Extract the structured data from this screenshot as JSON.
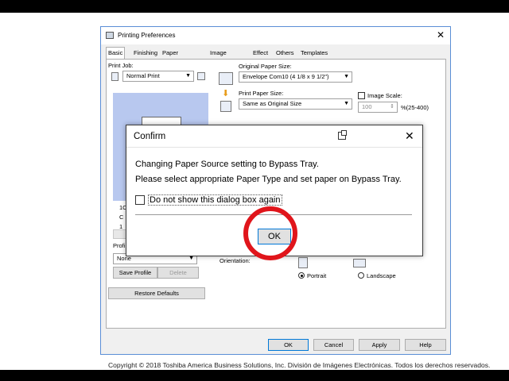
{
  "window": {
    "title": "Printing Preferences",
    "close_glyph": "✕",
    "tabs": [
      {
        "label": "Basic",
        "active": true
      },
      {
        "label": "Finishing"
      },
      {
        "label": "Paper Handling"
      },
      {
        "label": "Image Quality"
      },
      {
        "label": "Effect"
      },
      {
        "label": "Others"
      },
      {
        "label": "Templates"
      }
    ]
  },
  "basic": {
    "print_job_label": "Print Job:",
    "print_job_value": "Normal Print",
    "original_paper_size_label": "Original Paper Size:",
    "original_paper_size_value": "Envelope Com10 (4 1/8 x 9 1/2\")",
    "print_paper_size_label": "Print Paper Size:",
    "print_paper_size_value": "Same as Original Size",
    "image_scale_label": "Image Scale:",
    "image_scale_value": "100",
    "image_scale_range": "%(25-400)",
    "profile_label": "Profi",
    "profile_value": "None",
    "save_profile_label": "Save Profile",
    "delete_label": "Delete",
    "restore_defaults_label": "Restore Defaults",
    "orientation_label": "Orientation:",
    "portrait_label": "Portrait",
    "landscape_label": "Landscape",
    "orientation_selected": "Portrait",
    "preview_partial_1": "1C",
    "preview_partial_2": "C",
    "preview_partial_3": "1"
  },
  "footer_buttons": {
    "ok": "OK",
    "cancel": "Cancel",
    "apply": "Apply",
    "help": "Help"
  },
  "dialog": {
    "title": "Confirm",
    "close_glyph": "✕",
    "message_line1": "Changing Paper Source setting to Bypass Tray.",
    "message_line2": "Please select appropriate Paper Type and set paper on Bypass Tray.",
    "checkbox_label": "Do not show this dialog box again",
    "checkbox_checked": false,
    "ok_label": "OK"
  },
  "annotation": {
    "highlight_color": "#e0151b",
    "target": "OK"
  },
  "colors": {
    "window_border": "#5a8ed6",
    "preview_bg": "#b8c8ef",
    "default_button_border": "#0078d7",
    "arrow_icon": "#e89c1a"
  },
  "copyright": "Copyright © 2018 Toshiba America Business Solutions, Inc. División de Imágenes Electrónicas. Todos los derechos reservados."
}
